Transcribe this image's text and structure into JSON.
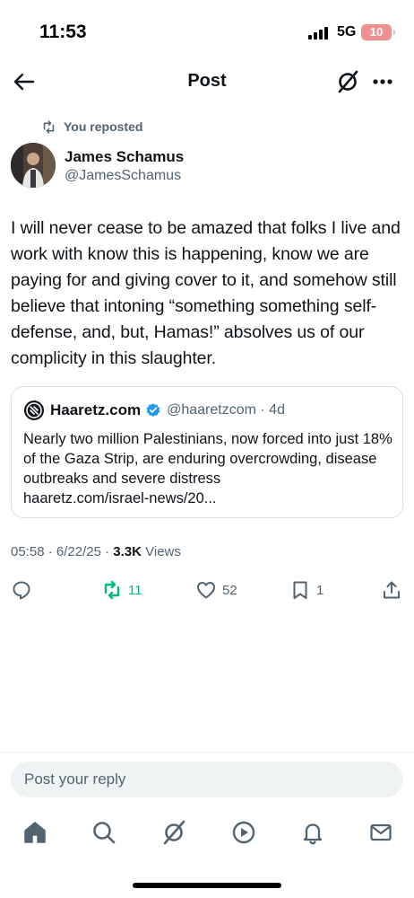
{
  "status_bar": {
    "time": "11:53",
    "network": "5G",
    "battery": "10"
  },
  "header": {
    "title": "Post"
  },
  "repost_indicator": {
    "label": "You reposted"
  },
  "post": {
    "author_name": "James Schamus",
    "author_handle": "@JamesSchamus",
    "text": "I will never cease to be amazed that folks I live and work with know this is happening, know we are paying for and giving cover to it, and somehow still believe that intoning “something something self-defense, and, but, Hamas!” absolves us of our complicity in this slaughter.",
    "time": "05:58",
    "date": "6/22/25",
    "views_count": "3.3K",
    "views_label": "Views"
  },
  "quote": {
    "name": "Haaretz.com",
    "handle": "@haaretzcom",
    "age": "4d",
    "text": "Nearly two million Palestinians, now forced into just 18% of the Gaza Strip, are enduring overcrowding, disease outbreaks and severe distress",
    "link": "haaretz.com/israel-news/20..."
  },
  "actions": {
    "reposts": "11",
    "likes": "52",
    "bookmarks": "1"
  },
  "reply_bar": {
    "placeholder": "Post your reply"
  },
  "colors": {
    "text": "#0f1419",
    "secondary": "#536471",
    "repost_active": "#00ba7c",
    "verified": "#1d9bf0",
    "battery_low": "#f08f8f",
    "divider": "#eff3f4"
  },
  "tabs": [
    "home-icon",
    "search-icon",
    "grok-icon",
    "video-icon",
    "notifications-icon",
    "messages-icon"
  ]
}
